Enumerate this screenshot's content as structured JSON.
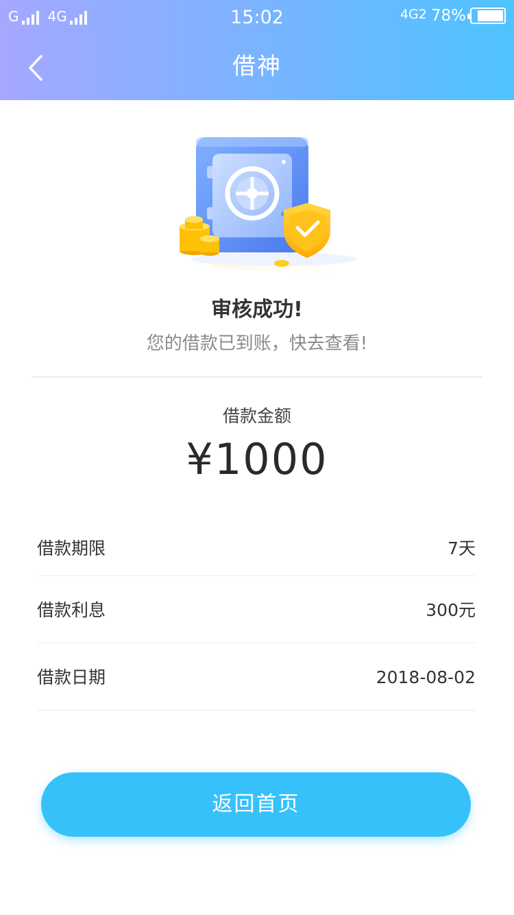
{
  "status_bar": {
    "carrier1": "G",
    "carrier2": "4G",
    "time": "15:02",
    "network": "4G2",
    "battery": "78%",
    "battery_level": 0.78
  },
  "nav": {
    "back_icon": "chevron-left-icon",
    "title": "借神"
  },
  "hero": {
    "illustration": "safe-with-shield-and-coins"
  },
  "result": {
    "title": "审核成功!",
    "subtitle": "您的借款已到账，快去查看!"
  },
  "amount": {
    "label": "借款金额",
    "value": "¥1000"
  },
  "details": [
    {
      "label": "借款期限",
      "value": "7天"
    },
    {
      "label": "借款利息",
      "value": "300元"
    },
    {
      "label": "借款日期",
      "value": "2018-08-02"
    }
  ],
  "button": {
    "label": "返回首页"
  },
  "colors": {
    "header_start": "#a5a8ff",
    "header_end": "#4ec3ff",
    "button": "#36c1fb",
    "safe": "#5b8cf5",
    "shield": "#ffc21a",
    "coin": "#ffcd1f"
  }
}
